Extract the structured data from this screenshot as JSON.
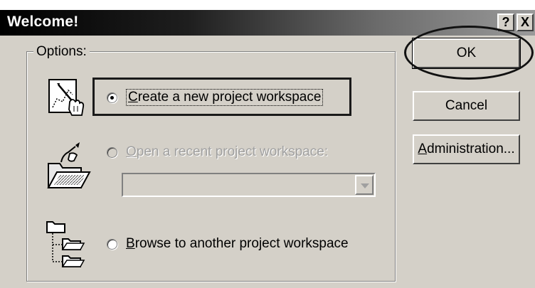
{
  "window": {
    "title": "Welcome!",
    "help_label": "?",
    "close_label": "X"
  },
  "options": {
    "group_label": "Options:",
    "create": {
      "mnemonic": "C",
      "rest": "reate a new project workspace",
      "checked": true
    },
    "open_recent": {
      "mnemonic": "O",
      "rest": "pen a recent project workspace:",
      "enabled": false,
      "combo_value": ""
    },
    "browse": {
      "mnemonic": "B",
      "rest": "rowse to another project workspace",
      "checked": false
    }
  },
  "buttons": {
    "ok_label": "OK",
    "cancel_label": "Cancel",
    "admin_mnemonic": "A",
    "admin_rest": "dministration..."
  },
  "icons": {
    "create": "new-workspace-icon",
    "open": "open-folder-icon",
    "browse": "folder-tree-icon"
  }
}
